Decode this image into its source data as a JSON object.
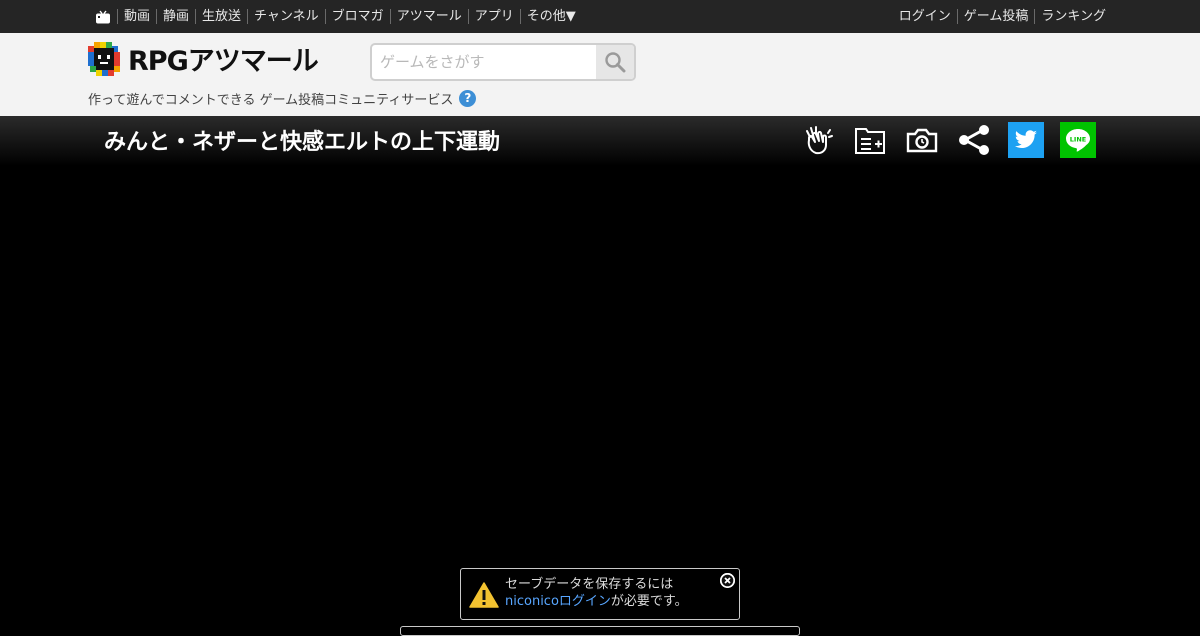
{
  "topnav": {
    "left_items": [
      "動画",
      "静画",
      "生放送",
      "チャンネル",
      "ブロマガ",
      "アツマール",
      "アプリ",
      "その他▼"
    ],
    "right_items": [
      "ログイン",
      "ゲーム投稿",
      "ランキング"
    ]
  },
  "header": {
    "logo_text": "RPGアツマール",
    "search_placeholder": "ゲームをさがす",
    "tagline": "作って遊んでコメントできる ゲーム投稿コミュニティサービス",
    "help_label": "?"
  },
  "game": {
    "title": "みんと・ネザーと快感エルトの上下運動",
    "actions": [
      "clap-icon",
      "add-to-list-icon",
      "screenshot-camera-icon",
      "share-icon",
      "twitter-icon",
      "line-icon"
    ],
    "line_label": "LINE"
  },
  "notice": {
    "line1": "セーブデータを保存するには",
    "link": "niconicoログイン",
    "line2_suffix": "が必要です。"
  },
  "colors": {
    "topbar": "#252525",
    "header": "#f3f3f3",
    "twitter": "#1da1f2",
    "line": "#00c300",
    "link": "#58a6ff",
    "help": "#3d8fd6"
  }
}
